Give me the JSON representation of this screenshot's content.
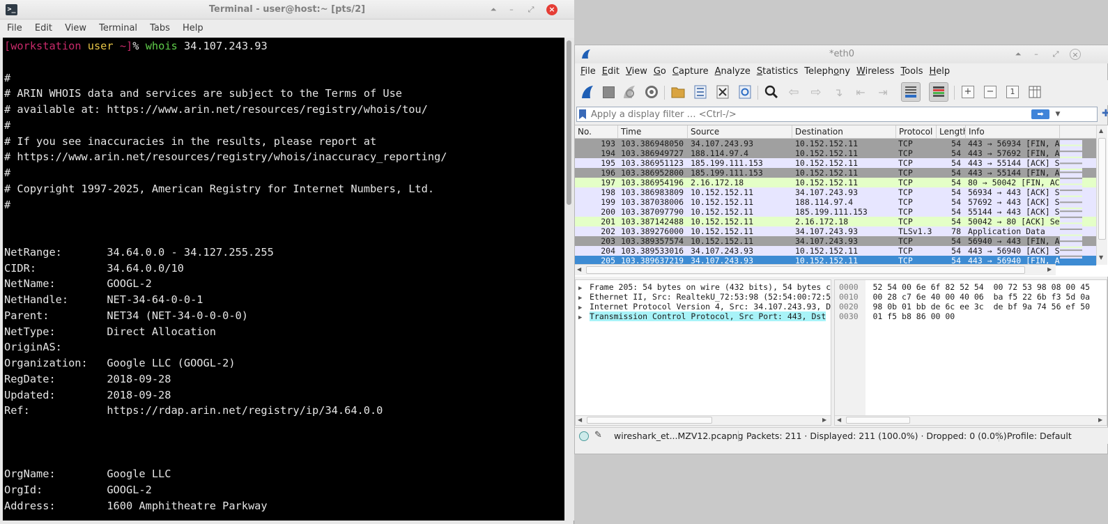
{
  "terminal": {
    "title": "Terminal - user@host:~ [pts/2]",
    "menu": [
      "File",
      "Edit",
      "View",
      "Terminal",
      "Tabs",
      "Help"
    ],
    "prompt": {
      "open": "[",
      "host": "workstation",
      "user": "user",
      "path": "~",
      "close": "]",
      "symbol": "%",
      "command": "whois",
      "arg": "34.107.243.93"
    },
    "output": "\n#\n# ARIN WHOIS data and services are subject to the Terms of Use\n# available at: https://www.arin.net/resources/registry/whois/tou/\n#\n# If you see inaccuracies in the results, please report at\n# https://www.arin.net/resources/registry/whois/inaccuracy_reporting/\n#\n# Copyright 1997-2025, American Registry for Internet Numbers, Ltd.\n#\n\n\nNetRange:       34.64.0.0 - 34.127.255.255\nCIDR:           34.64.0.0/10\nNetName:        GOOGL-2\nNetHandle:      NET-34-64-0-0-1\nParent:         NET34 (NET-34-0-0-0-0)\nNetType:        Direct Allocation\nOriginAS:\nOrganization:   Google LLC (GOOGL-2)\nRegDate:        2018-09-28\nUpdated:        2018-09-28\nRef:            https://rdap.arin.net/registry/ip/34.64.0.0\n\n\n\nOrgName:        Google LLC\nOrgId:          GOOGL-2\nAddress:        1600 Amphitheatre Parkway"
  },
  "wireshark": {
    "title": "*eth0",
    "menu": [
      {
        "label": "File",
        "u": "F",
        "rest": "ile"
      },
      {
        "label": "Edit",
        "u": "E",
        "rest": "dit"
      },
      {
        "label": "View",
        "u": "V",
        "rest": "iew"
      },
      {
        "label": "Go",
        "u": "G",
        "rest": "o"
      },
      {
        "label": "Capture",
        "u": "C",
        "rest": "apture"
      },
      {
        "label": "Analyze",
        "u": "A",
        "rest": "nalyze"
      },
      {
        "label": "Statistics",
        "u": "S",
        "rest": "tatistics"
      },
      {
        "label": "Telephony",
        "u": "y",
        "pre": "Teleph",
        "u2": "o",
        "rest": "ny"
      },
      {
        "label": "Wireless",
        "u": "W",
        "rest": "ireless"
      },
      {
        "label": "Tools",
        "u": "T",
        "rest": "ools"
      },
      {
        "label": "Help",
        "u": "H",
        "rest": "elp"
      }
    ],
    "filter": {
      "placeholder": "Apply a display filter … <Ctrl-/>"
    },
    "columns": [
      "No.",
      "Time",
      "Source",
      "Destination",
      "Protocol",
      "Length",
      "Info"
    ],
    "packets": [
      {
        "no": "193",
        "time": "103.386948050",
        "src": "34.107.243.93",
        "dst": "10.152.152.11",
        "proto": "TCP",
        "len": "54",
        "info": "443 → 56934 [FIN, A",
        "bg": "#a0a0a0"
      },
      {
        "no": "194",
        "time": "103.386949727",
        "src": "188.114.97.4",
        "dst": "10.152.152.11",
        "proto": "TCP",
        "len": "54",
        "info": "443 → 57692 [FIN, A",
        "bg": "#a0a0a0"
      },
      {
        "no": "195",
        "time": "103.386951123",
        "src": "185.199.111.153",
        "dst": "10.152.152.11",
        "proto": "TCP",
        "len": "54",
        "info": "443 → 55144 [ACK] S",
        "bg": "#e7e6ff"
      },
      {
        "no": "196",
        "time": "103.386952800",
        "src": "185.199.111.153",
        "dst": "10.152.152.11",
        "proto": "TCP",
        "len": "54",
        "info": "443 → 55144 [FIN, A",
        "bg": "#a0a0a0"
      },
      {
        "no": "197",
        "time": "103.386954196",
        "src": "2.16.172.18",
        "dst": "10.152.152.11",
        "proto": "TCP",
        "len": "54",
        "info": "80 → 50042 [FIN, AC",
        "bg": "#e4ffc7"
      },
      {
        "no": "198",
        "time": "103.386983809",
        "src": "10.152.152.11",
        "dst": "34.107.243.93",
        "proto": "TCP",
        "len": "54",
        "info": "56934 → 443 [ACK] S",
        "bg": "#e7e6ff"
      },
      {
        "no": "199",
        "time": "103.387038006",
        "src": "10.152.152.11",
        "dst": "188.114.97.4",
        "proto": "TCP",
        "len": "54",
        "info": "57692 → 443 [ACK] S",
        "bg": "#e7e6ff"
      },
      {
        "no": "200",
        "time": "103.387097790",
        "src": "10.152.152.11",
        "dst": "185.199.111.153",
        "proto": "TCP",
        "len": "54",
        "info": "55144 → 443 [ACK] S",
        "bg": "#e7e6ff"
      },
      {
        "no": "201",
        "time": "103.387142488",
        "src": "10.152.152.11",
        "dst": "2.16.172.18",
        "proto": "TCP",
        "len": "54",
        "info": "50042 → 80 [ACK] Se",
        "bg": "#e4ffc7"
      },
      {
        "no": "202",
        "time": "103.389276000",
        "src": "10.152.152.11",
        "dst": "34.107.243.93",
        "proto": "TLSv1.3",
        "len": "78",
        "info": "Application Data",
        "bg": "#e7e6ff"
      },
      {
        "no": "203",
        "time": "103.389357574",
        "src": "10.152.152.11",
        "dst": "34.107.243.93",
        "proto": "TCP",
        "len": "54",
        "info": "56940 → 443 [FIN, A",
        "bg": "#a0a0a0"
      },
      {
        "no": "204",
        "time": "103.389533016",
        "src": "34.107.243.93",
        "dst": "10.152.152.11",
        "proto": "TCP",
        "len": "54",
        "info": "443 → 56940 [ACK] S",
        "bg": "#e7e6ff"
      },
      {
        "no": "205",
        "time": "103.389637219",
        "src": "34.107.243.93",
        "dst": "10.152.152.11",
        "proto": "TCP",
        "len": "54",
        "info": "443 → 56940 [FIN, A",
        "bg": "#3d8bd3",
        "selected": true
      }
    ],
    "details": [
      {
        "text": "Frame 205: 54 bytes on wire (432 bits), 54 bytes c"
      },
      {
        "text": "Ethernet II, Src: RealtekU_72:53:98 (52:54:00:72:5"
      },
      {
        "text": "Internet Protocol Version 4, Src: 34.107.243.93, D"
      },
      {
        "text": "Transmission Control Protocol, Src Port: 443, Dst",
        "highlight": true
      }
    ],
    "bytes": [
      {
        "off": "0000",
        "hex": "52 54 00 6e 6f 82 52 54  00 72 53 98 08 00 45"
      },
      {
        "off": "0010",
        "hex": "00 28 c7 6e 40 00 40 06  ba f5 22 6b f3 5d 0a"
      },
      {
        "off": "0020",
        "hex": "98 0b 01 bb de 6c ee 3c  de bf 9a 74 56 ef 50"
      },
      {
        "off": "0030",
        "hex": "01 f5 b8 86 00 00"
      }
    ],
    "status": {
      "file": "wireshark_et...MZV12.pcapng",
      "packets": "Packets: 211 · Displayed: 211 (100.0%) · Dropped: 0 (0.0%)",
      "profile": "Profile: Default"
    }
  }
}
